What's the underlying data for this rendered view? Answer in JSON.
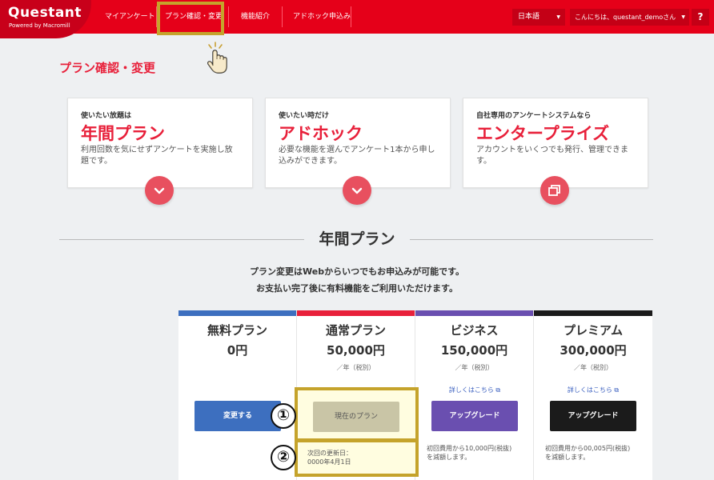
{
  "header": {
    "logo": "Questant",
    "logo_sub": "Powered by Macromill",
    "nav": [
      "マイアンケート",
      "プラン確認・変更",
      "機能紹介",
      "アドホック申込み"
    ],
    "language": "日本語",
    "greeting": "こんにちは、questant_demoさん",
    "help": "?"
  },
  "page_title": "プラン確認・変更",
  "cards": [
    {
      "sub": "使いたい放題は",
      "title": "年間プラン",
      "desc": "利用回数を気にせずアンケートを実施し放題です。",
      "icon": "chevron-down-icon"
    },
    {
      "sub": "使いたい時だけ",
      "title": "アドホック",
      "desc": "必要な機能を選んでアンケート1本から申し込みができます。",
      "icon": "chevron-down-icon"
    },
    {
      "sub": "自社専用のアンケートシステムなら",
      "title": "エンタープライズ",
      "desc": "アカウントをいくつでも発行、管理できます。",
      "icon": "external-window-icon"
    }
  ],
  "section": {
    "title": "年間プラン",
    "intro1": "プラン変更はWebからいつでもお申込みが可能です。",
    "intro2": "お支払い完了後に有料機能をご利用いただけます。"
  },
  "plans": [
    {
      "name": "無料プラン",
      "price": "0円",
      "unit": "",
      "link": "",
      "button": "変更する",
      "note1": "",
      "note2": "",
      "color": "#3d6fbf",
      "btn_color": "#3d6fbf"
    },
    {
      "name": "通常プラン",
      "price": "50,000円",
      "unit": "／年（税別）",
      "link": "",
      "button": "現在のプラン",
      "note1": "次回の更新日：",
      "note2": "0000年4月1日",
      "color": "#e8203a",
      "btn_color": "#c9c5a6"
    },
    {
      "name": "ビジネス",
      "price": "150,000円",
      "unit": "／年（税別）",
      "link": "詳しくはこちら",
      "button": "アップグレード",
      "note1": "初回費用から10,000円(税抜)",
      "note2": "を減額します。",
      "color": "#6a4fb0",
      "btn_color": "#6a4fb0"
    },
    {
      "name": "プレミアム",
      "price": "300,000円",
      "unit": "／年（税別）",
      "link": "詳しくはこちら",
      "button": "アップグレード",
      "note1": "初回費用から00,005円(税抜)",
      "note2": "を減額します。",
      "color": "#1b1b1b",
      "btn_color": "#1b1b1b"
    }
  ],
  "markers": [
    "①",
    "②"
  ],
  "colors": {
    "brand_red": "#e50019",
    "highlight": "#c5a32b"
  }
}
